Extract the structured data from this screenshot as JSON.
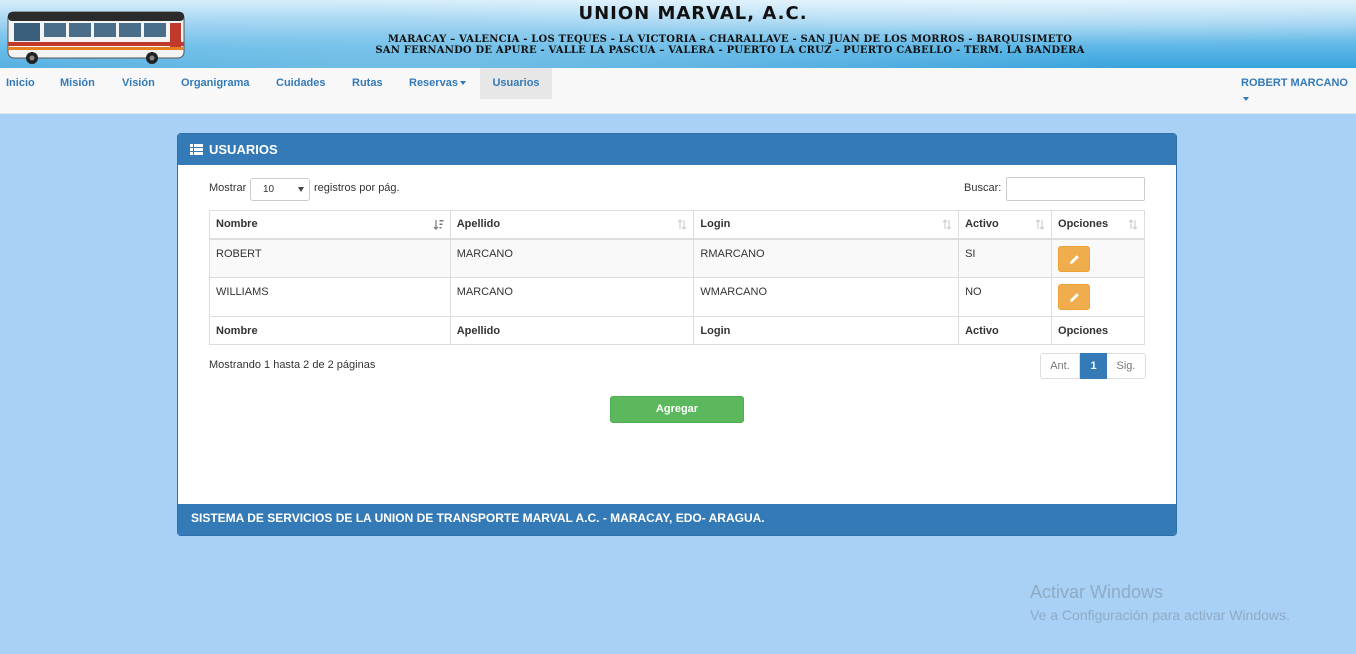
{
  "banner": {
    "title": "UNION MARVAL, A.C.",
    "routes_line1": "MARACAY – VALENCIA - LOS TEQUES - LA VICTORIA – CHARALLAVE - SAN JUAN DE LOS MORROS - BARQUISIMETO",
    "routes_line2": "SAN FERNANDO DE APURE - VALLE LA PASCUA – VALERA - PUERTO LA CRUZ - PUERTO CABELLO - TERM. LA BANDERA"
  },
  "nav": {
    "items": [
      {
        "label": "Inicio"
      },
      {
        "label": "Misión"
      },
      {
        "label": "Visión"
      },
      {
        "label": "Organigrama"
      },
      {
        "label": "Cuidades"
      },
      {
        "label": "Rutas"
      },
      {
        "label": "Reservas"
      },
      {
        "label": "Usuarios"
      }
    ],
    "active": "Usuarios",
    "user": "ROBERT MARCANO"
  },
  "panel": {
    "title": "USUARIOS",
    "footer": "SISTEMA DE SERVICIOS DE LA UNION DE TRANSPORTE MARVAL A.C. - MARACAY, EDO- ARAGUA."
  },
  "table_controls": {
    "show_label": "Mostrar",
    "page_length": "10",
    "show_suffix": "registros por pág.",
    "search_label": "Buscar:",
    "search_value": ""
  },
  "table": {
    "columns": [
      "Nombre",
      "Apellido",
      "Login",
      "Activo",
      "Opciones"
    ],
    "rows": [
      {
        "nombre": "ROBERT",
        "apellido": "MARCANO",
        "login": "RMARCANO",
        "activo": "SI"
      },
      {
        "nombre": "WILLIAMS",
        "apellido": "MARCANO",
        "login": "WMARCANO",
        "activo": "NO"
      }
    ]
  },
  "pagination": {
    "info": "Mostrando 1 hasta 2 de 2 páginas",
    "prev": "Ant.",
    "current": "1",
    "next": "Sig."
  },
  "actions": {
    "add_label": "Agregar"
  },
  "watermark": {
    "title": "Activar Windows",
    "subtitle": "Ve a Configuración para activar Windows."
  },
  "colors": {
    "primary": "#337ab7",
    "warning": "#f0ad4e",
    "success": "#5cb85c",
    "background": "#a9d0f5"
  }
}
